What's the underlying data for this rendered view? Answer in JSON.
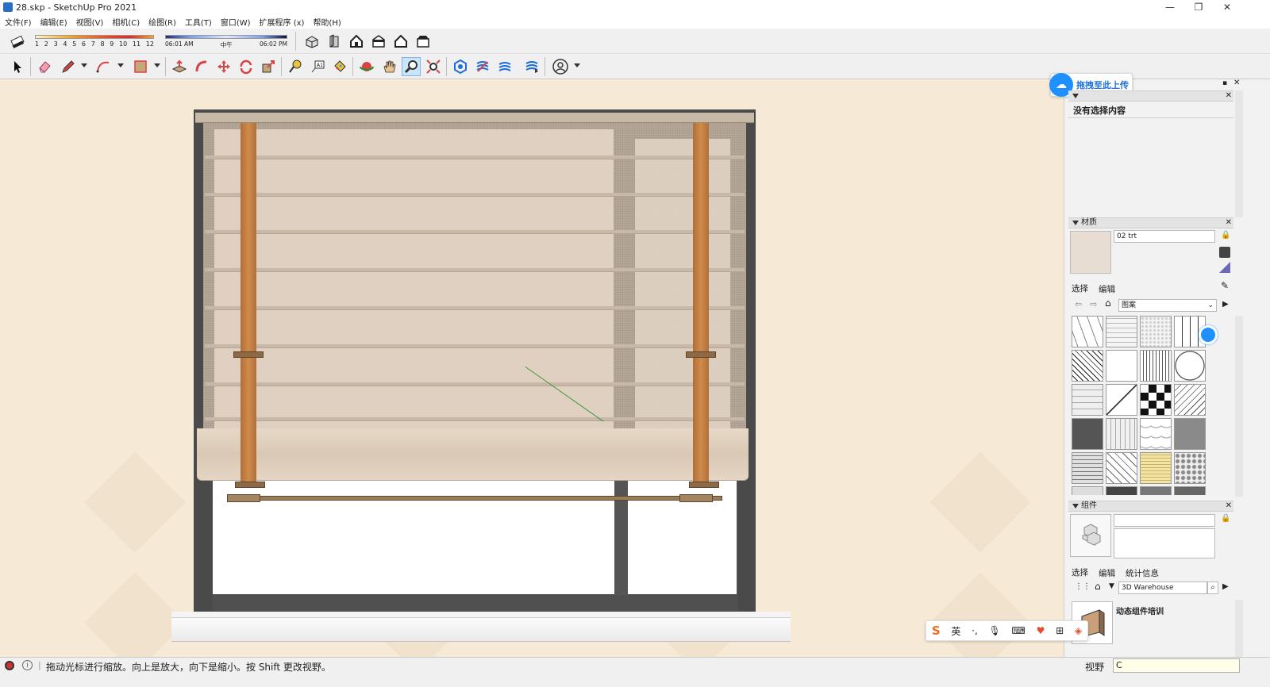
{
  "window": {
    "title": "28.skp - SketchUp Pro 2021",
    "minimize": "—",
    "restore": "❐",
    "close": "✕"
  },
  "menu": [
    "文件(F)",
    "编辑(E)",
    "视图(V)",
    "相机(C)",
    "绘图(R)",
    "工具(T)",
    "窗口(W)",
    "扩展程序 (x)",
    "帮助(H)"
  ],
  "shadow_settings": {
    "months": [
      "1",
      "2",
      "3",
      "4",
      "5",
      "6",
      "7",
      "8",
      "9",
      "10",
      "11",
      "12"
    ],
    "time_start": "06:01 AM",
    "time_mid": "中午",
    "time_end": "06:02 PM"
  },
  "upload_button": {
    "label": "拖拽至此上传"
  },
  "entity_info": {
    "status": "没有选择内容"
  },
  "materials": {
    "header": "材质",
    "name_value": "02 trt",
    "tab_select": "选择",
    "tab_edit": "编辑",
    "library": "图案"
  },
  "components": {
    "header": "组件",
    "tab_select": "选择",
    "tab_edit": "编辑",
    "tab_stats": "统计信息",
    "search_placeholder": "3D Warehouse",
    "item1": "动态组件培训"
  },
  "status": {
    "message": "拖动光标进行缩放。向上是放大，向下是缩小。按 Shift 更改视野。",
    "field_label": "视野",
    "field_value": "C"
  },
  "ime": {
    "lang": "英"
  },
  "colors": {
    "viewport_bg": "#f6e9d5",
    "strap": "#c7803f",
    "accent_blue": "#1e90ff"
  }
}
